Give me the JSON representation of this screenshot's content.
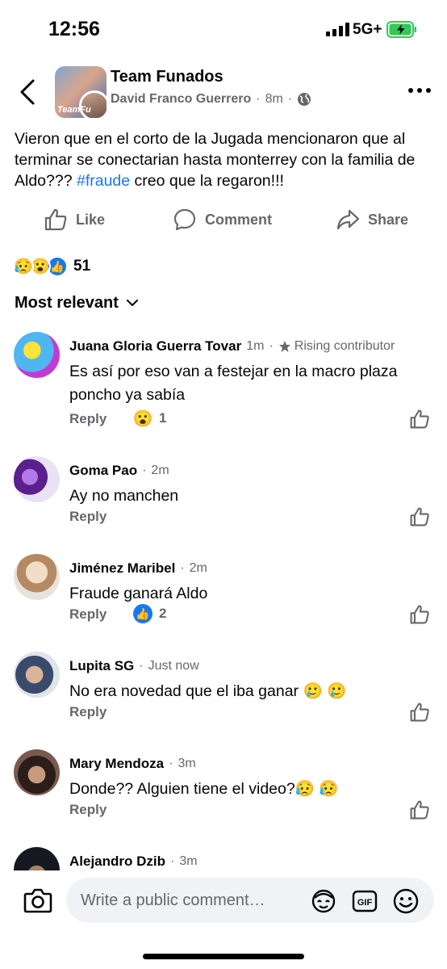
{
  "status_bar": {
    "time": "12:56",
    "network": "5G+"
  },
  "header": {
    "group_name": "Team Funados",
    "avatar_text": "TeamFu",
    "author": "David Franco Guerrero",
    "time": "8m",
    "separator": "·",
    "privacy_icon": "globe-icon"
  },
  "post": {
    "text_before": "Vieron que en el corto de la Jugada mencionaron que al terminar se conectarian hasta monterrey con la familia de Aldo??? ",
    "hashtag": "#fraude",
    "text_after": " creo que la regaron!!!",
    "hashtag_color": "#1877f2"
  },
  "actions": {
    "like": "Like",
    "comment": "Comment",
    "share": "Share"
  },
  "reactions": {
    "emojis": [
      "😥",
      "😮",
      "👍"
    ],
    "count": "51"
  },
  "sort": {
    "label": "Most relevant"
  },
  "comments": [
    {
      "name": "Juana Gloria Guerra Tovar",
      "time": "1m",
      "badge": "Rising contributor",
      "text": "Es así por eso van a festejar en la macro plaza poncho ya sabía",
      "reply": "Reply",
      "reaction_emoji": "😮",
      "reaction_count": "1"
    },
    {
      "name": "Goma Pao",
      "time": "2m",
      "text": "Ay no manchen",
      "reply": "Reply"
    },
    {
      "name": "Jiménez Maribel",
      "time": "2m",
      "text": "Fraude ganará Aldo",
      "reply": "Reply",
      "reaction_emoji": "👍",
      "reaction_count": "2"
    },
    {
      "name": "Lupita SG",
      "time": "Just now",
      "text": "No era novedad que el iba ganar 🥲 🥲",
      "reply": "Reply"
    },
    {
      "name": "Mary Mendoza",
      "time": "3m",
      "text": "Donde?? Alguien tiene el video?😥 😥",
      "reply": "Reply"
    },
    {
      "name": "Alejandro Dzib",
      "time": "3m"
    }
  ],
  "composer": {
    "placeholder": "Write a public comment…"
  },
  "colors": {
    "accent": "#1877f2",
    "muted": "#65676b",
    "input_bg": "#f0f2f5",
    "battery_green": "#34c759"
  }
}
